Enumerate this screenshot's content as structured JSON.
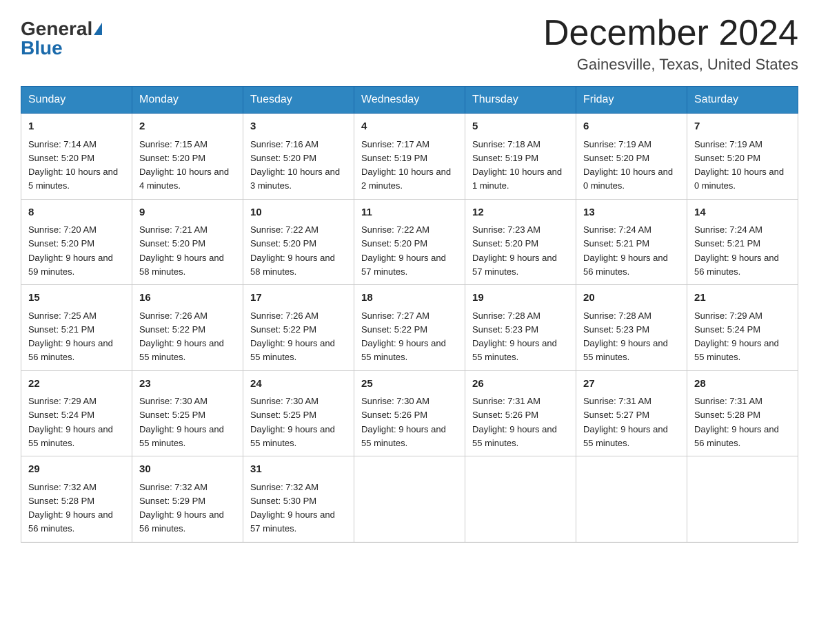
{
  "header": {
    "logo_general": "General",
    "logo_blue": "Blue",
    "month_title": "December 2024",
    "location": "Gainesville, Texas, United States"
  },
  "days_of_week": [
    "Sunday",
    "Monday",
    "Tuesday",
    "Wednesday",
    "Thursday",
    "Friday",
    "Saturday"
  ],
  "weeks": [
    [
      {
        "day": "1",
        "sunrise": "7:14 AM",
        "sunset": "5:20 PM",
        "daylight": "10 hours and 5 minutes."
      },
      {
        "day": "2",
        "sunrise": "7:15 AM",
        "sunset": "5:20 PM",
        "daylight": "10 hours and 4 minutes."
      },
      {
        "day": "3",
        "sunrise": "7:16 AM",
        "sunset": "5:20 PM",
        "daylight": "10 hours and 3 minutes."
      },
      {
        "day": "4",
        "sunrise": "7:17 AM",
        "sunset": "5:19 PM",
        "daylight": "10 hours and 2 minutes."
      },
      {
        "day": "5",
        "sunrise": "7:18 AM",
        "sunset": "5:19 PM",
        "daylight": "10 hours and 1 minute."
      },
      {
        "day": "6",
        "sunrise": "7:19 AM",
        "sunset": "5:20 PM",
        "daylight": "10 hours and 0 minutes."
      },
      {
        "day": "7",
        "sunrise": "7:19 AM",
        "sunset": "5:20 PM",
        "daylight": "10 hours and 0 minutes."
      }
    ],
    [
      {
        "day": "8",
        "sunrise": "7:20 AM",
        "sunset": "5:20 PM",
        "daylight": "9 hours and 59 minutes."
      },
      {
        "day": "9",
        "sunrise": "7:21 AM",
        "sunset": "5:20 PM",
        "daylight": "9 hours and 58 minutes."
      },
      {
        "day": "10",
        "sunrise": "7:22 AM",
        "sunset": "5:20 PM",
        "daylight": "9 hours and 58 minutes."
      },
      {
        "day": "11",
        "sunrise": "7:22 AM",
        "sunset": "5:20 PM",
        "daylight": "9 hours and 57 minutes."
      },
      {
        "day": "12",
        "sunrise": "7:23 AM",
        "sunset": "5:20 PM",
        "daylight": "9 hours and 57 minutes."
      },
      {
        "day": "13",
        "sunrise": "7:24 AM",
        "sunset": "5:21 PM",
        "daylight": "9 hours and 56 minutes."
      },
      {
        "day": "14",
        "sunrise": "7:24 AM",
        "sunset": "5:21 PM",
        "daylight": "9 hours and 56 minutes."
      }
    ],
    [
      {
        "day": "15",
        "sunrise": "7:25 AM",
        "sunset": "5:21 PM",
        "daylight": "9 hours and 56 minutes."
      },
      {
        "day": "16",
        "sunrise": "7:26 AM",
        "sunset": "5:22 PM",
        "daylight": "9 hours and 55 minutes."
      },
      {
        "day": "17",
        "sunrise": "7:26 AM",
        "sunset": "5:22 PM",
        "daylight": "9 hours and 55 minutes."
      },
      {
        "day": "18",
        "sunrise": "7:27 AM",
        "sunset": "5:22 PM",
        "daylight": "9 hours and 55 minutes."
      },
      {
        "day": "19",
        "sunrise": "7:28 AM",
        "sunset": "5:23 PM",
        "daylight": "9 hours and 55 minutes."
      },
      {
        "day": "20",
        "sunrise": "7:28 AM",
        "sunset": "5:23 PM",
        "daylight": "9 hours and 55 minutes."
      },
      {
        "day": "21",
        "sunrise": "7:29 AM",
        "sunset": "5:24 PM",
        "daylight": "9 hours and 55 minutes."
      }
    ],
    [
      {
        "day": "22",
        "sunrise": "7:29 AM",
        "sunset": "5:24 PM",
        "daylight": "9 hours and 55 minutes."
      },
      {
        "day": "23",
        "sunrise": "7:30 AM",
        "sunset": "5:25 PM",
        "daylight": "9 hours and 55 minutes."
      },
      {
        "day": "24",
        "sunrise": "7:30 AM",
        "sunset": "5:25 PM",
        "daylight": "9 hours and 55 minutes."
      },
      {
        "day": "25",
        "sunrise": "7:30 AM",
        "sunset": "5:26 PM",
        "daylight": "9 hours and 55 minutes."
      },
      {
        "day": "26",
        "sunrise": "7:31 AM",
        "sunset": "5:26 PM",
        "daylight": "9 hours and 55 minutes."
      },
      {
        "day": "27",
        "sunrise": "7:31 AM",
        "sunset": "5:27 PM",
        "daylight": "9 hours and 55 minutes."
      },
      {
        "day": "28",
        "sunrise": "7:31 AM",
        "sunset": "5:28 PM",
        "daylight": "9 hours and 56 minutes."
      }
    ],
    [
      {
        "day": "29",
        "sunrise": "7:32 AM",
        "sunset": "5:28 PM",
        "daylight": "9 hours and 56 minutes."
      },
      {
        "day": "30",
        "sunrise": "7:32 AM",
        "sunset": "5:29 PM",
        "daylight": "9 hours and 56 minutes."
      },
      {
        "day": "31",
        "sunrise": "7:32 AM",
        "sunset": "5:30 PM",
        "daylight": "9 hours and 57 minutes."
      },
      null,
      null,
      null,
      null
    ]
  ]
}
